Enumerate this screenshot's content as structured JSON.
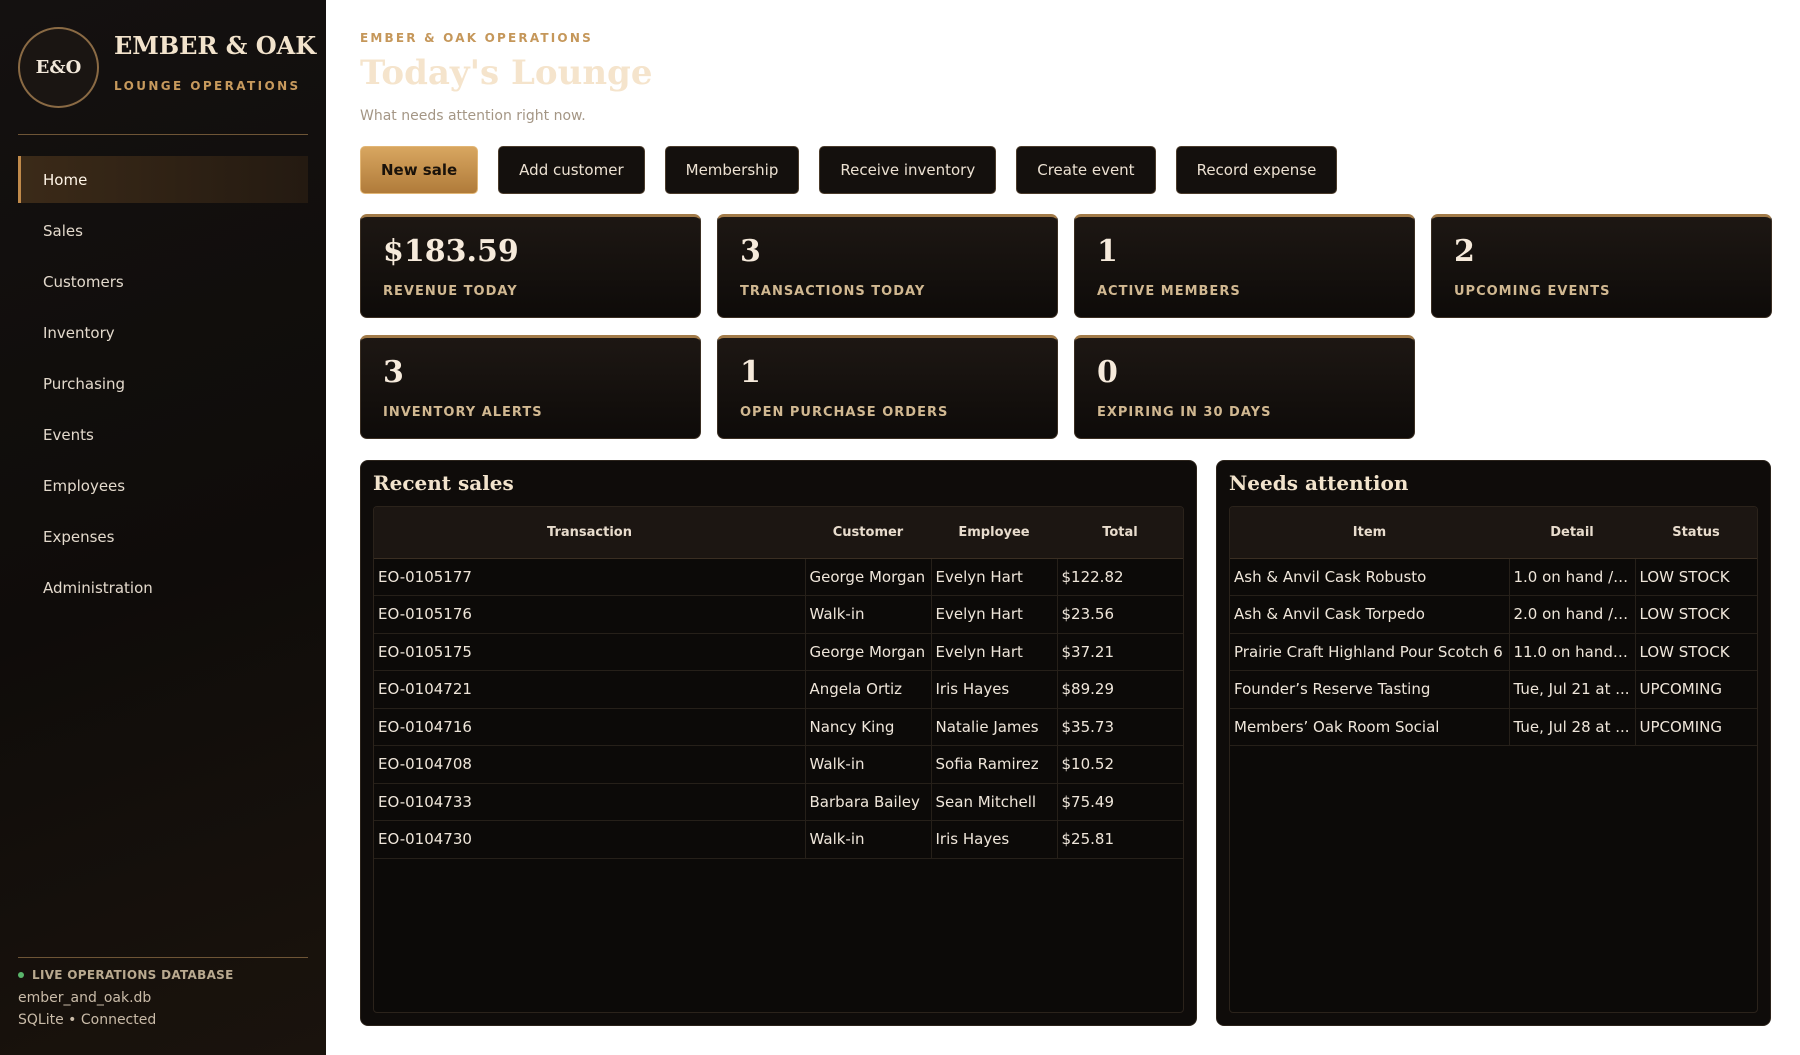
{
  "brand": {
    "logo": "E&O",
    "name": "EMBER & OAK",
    "subtitle": "LOUNGE OPERATIONS"
  },
  "nav": [
    {
      "label": "Home",
      "active": true
    },
    {
      "label": "Sales"
    },
    {
      "label": "Customers"
    },
    {
      "label": "Inventory"
    },
    {
      "label": "Purchasing"
    },
    {
      "label": "Events"
    },
    {
      "label": "Employees"
    },
    {
      "label": "Expenses"
    },
    {
      "label": "Administration"
    }
  ],
  "sidebar_footer": {
    "status": "LIVE OPERATIONS DATABASE",
    "db_name": "ember_and_oak.db",
    "db_status": "SQLite • Connected"
  },
  "header": {
    "eyebrow": "EMBER & OAK OPERATIONS",
    "title": "Today's Lounge",
    "subtitle": "What needs attention right now."
  },
  "actions": [
    "New sale",
    "Add customer",
    "Membership",
    "Receive inventory",
    "Create event",
    "Record expense"
  ],
  "metrics": [
    {
      "value": "$183.59",
      "label": "REVENUE TODAY"
    },
    {
      "value": "3",
      "label": "TRANSACTIONS TODAY"
    },
    {
      "value": "1",
      "label": "ACTIVE MEMBERS"
    },
    {
      "value": "2",
      "label": "UPCOMING EVENTS"
    },
    {
      "value": "3",
      "label": "INVENTORY ALERTS"
    },
    {
      "value": "1",
      "label": "OPEN PURCHASE ORDERS"
    },
    {
      "value": "0",
      "label": "EXPIRING IN 30 DAYS"
    }
  ],
  "recent_sales": {
    "title": "Recent sales",
    "columns": [
      "Transaction",
      "Customer",
      "Employee",
      "Total"
    ],
    "rows": [
      [
        "EO-0105177",
        "George Morgan",
        "Evelyn Hart",
        "$122.82"
      ],
      [
        "EO-0105176",
        "Walk-in",
        "Evelyn Hart",
        "$23.56"
      ],
      [
        "EO-0105175",
        "George Morgan",
        "Evelyn Hart",
        "$37.21"
      ],
      [
        "EO-0104721",
        "Angela Ortiz",
        "Iris Hayes",
        "$89.29"
      ],
      [
        "EO-0104716",
        "Nancy King",
        "Natalie James",
        "$35.73"
      ],
      [
        "EO-0104708",
        "Walk-in",
        "Sofia Ramirez",
        "$10.52"
      ],
      [
        "EO-0104733",
        "Barbara Bailey",
        "Sean Mitchell",
        "$75.49"
      ],
      [
        "EO-0104730",
        "Walk-in",
        "Iris Hayes",
        "$25.81"
      ]
    ]
  },
  "needs_attention": {
    "title": "Needs attention",
    "columns": [
      "Item",
      "Detail",
      "Status"
    ],
    "rows": [
      [
        "Ash & Anvil Cask Robusto",
        "1.0 on hand / ...",
        "LOW STOCK"
      ],
      [
        "Ash & Anvil Cask Torpedo",
        "2.0 on hand / ...",
        "LOW STOCK"
      ],
      [
        "Prairie Craft Highland Pour Scotch 6",
        "11.0 on hand /...",
        "LOW STOCK"
      ],
      [
        "Founder’s Reserve Tasting",
        "Tue, Jul 21 at ...",
        "UPCOMING"
      ],
      [
        "Members’ Oak Room Social",
        "Tue, Jul 28 at ...",
        "UPCOMING"
      ]
    ]
  },
  "colors": {
    "accent": "#c5975a",
    "sidebar_bg": "#100d0b",
    "panel_bg": "#0f0c0a",
    "status_dot": "#59b56b"
  }
}
